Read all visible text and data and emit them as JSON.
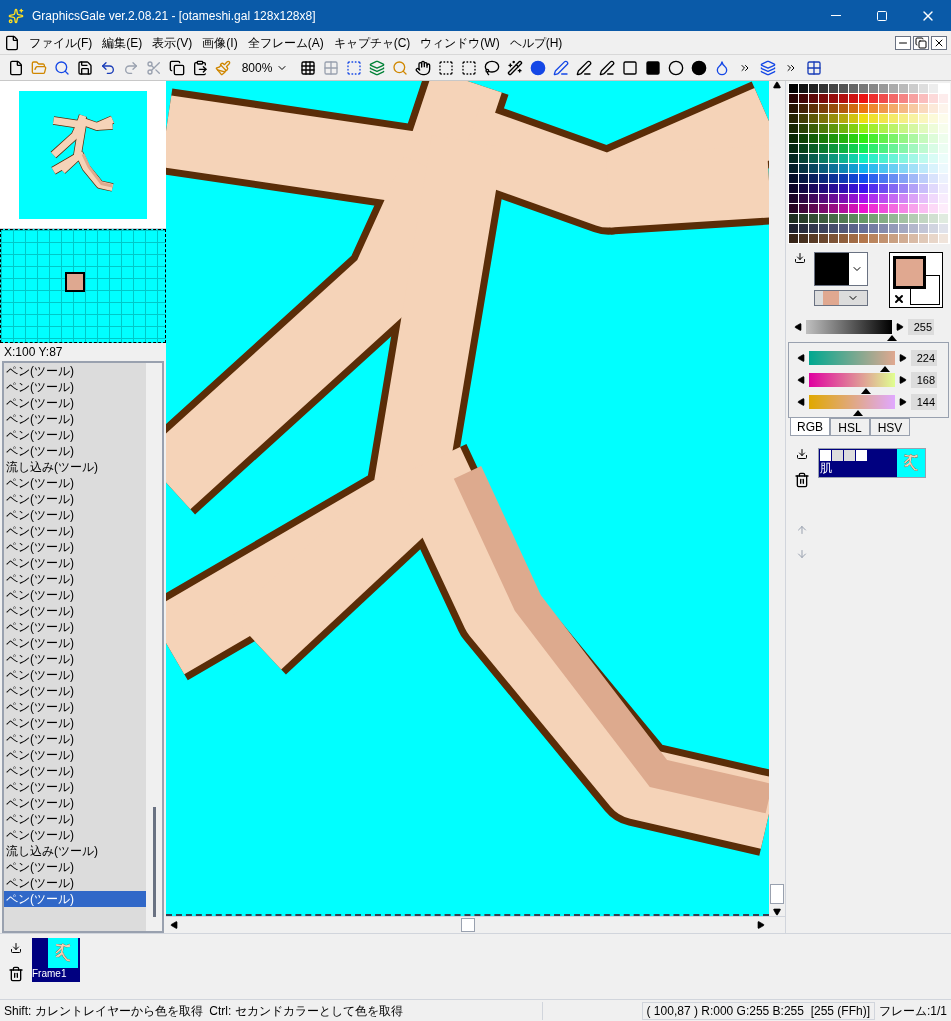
{
  "window": {
    "title": "GraphicsGale ver.2.08.21 - [otameshi.gal 128x128x8]"
  },
  "menu": [
    "ファイル(F)",
    "編集(E)",
    "表示(V)",
    "画像(I)",
    "全フレーム(A)",
    "キャプチャ(C)",
    "ウィンドウ(W)",
    "ヘルプ(H)"
  ],
  "toolbar": {
    "zoom": "800%"
  },
  "cursor_position": "X:100 Y:87",
  "history": [
    {
      "label": "ペン(ツール)",
      "selected": false
    },
    {
      "label": "ペン(ツール)",
      "selected": false
    },
    {
      "label": "ペン(ツール)",
      "selected": false
    },
    {
      "label": "ペン(ツール)",
      "selected": false
    },
    {
      "label": "ペン(ツール)",
      "selected": false
    },
    {
      "label": "ペン(ツール)",
      "selected": false
    },
    {
      "label": "流し込み(ツール)",
      "selected": false
    },
    {
      "label": "ペン(ツール)",
      "selected": false
    },
    {
      "label": "ペン(ツール)",
      "selected": false
    },
    {
      "label": "ペン(ツール)",
      "selected": false
    },
    {
      "label": "ペン(ツール)",
      "selected": false
    },
    {
      "label": "ペン(ツール)",
      "selected": false
    },
    {
      "label": "ペン(ツール)",
      "selected": false
    },
    {
      "label": "ペン(ツール)",
      "selected": false
    },
    {
      "label": "ペン(ツール)",
      "selected": false
    },
    {
      "label": "ペン(ツール)",
      "selected": false
    },
    {
      "label": "ペン(ツール)",
      "selected": false
    },
    {
      "label": "ペン(ツール)",
      "selected": false
    },
    {
      "label": "ペン(ツール)",
      "selected": false
    },
    {
      "label": "ペン(ツール)",
      "selected": false
    },
    {
      "label": "ペン(ツール)",
      "selected": false
    },
    {
      "label": "ペン(ツール)",
      "selected": false
    },
    {
      "label": "ペン(ツール)",
      "selected": false
    },
    {
      "label": "ペン(ツール)",
      "selected": false
    },
    {
      "label": "ペン(ツール)",
      "selected": false
    },
    {
      "label": "ペン(ツール)",
      "selected": false
    },
    {
      "label": "ペン(ツール)",
      "selected": false
    },
    {
      "label": "ペン(ツール)",
      "selected": false
    },
    {
      "label": "ペン(ツール)",
      "selected": false
    },
    {
      "label": "ペン(ツール)",
      "selected": false
    },
    {
      "label": "流し込み(ツール)",
      "selected": false
    },
    {
      "label": "ペン(ツール)",
      "selected": false
    },
    {
      "label": "ペン(ツール)",
      "selected": false
    },
    {
      "label": "ペン(ツール)",
      "selected": true
    }
  ],
  "sliders": {
    "gray": {
      "level": 1.0,
      "reading": "255"
    },
    "rgb": [
      {
        "kind": "red",
        "level": 0.878,
        "reading": "224"
      },
      {
        "kind": "green",
        "level": 0.659,
        "reading": "168"
      },
      {
        "kind": "blue",
        "level": 0.565,
        "reading": "144"
      }
    ]
  },
  "color_tabs": [
    {
      "label": "RGB",
      "selected": true
    },
    {
      "label": "HSL",
      "selected": false
    },
    {
      "label": "HSV",
      "selected": false
    }
  ],
  "layers": [
    {
      "name": "肌"
    }
  ],
  "frames": [
    {
      "name": "Frame1"
    }
  ],
  "status_bar": {
    "hint": "Shift: カレントレイヤーから色を取得  Ctrl: セカンドカラーとして色を取得",
    "pixel": "( 100,87 ) R:000 G:255 B:255  [255 (FFh)]",
    "frame": "フレーム:1/1"
  }
}
